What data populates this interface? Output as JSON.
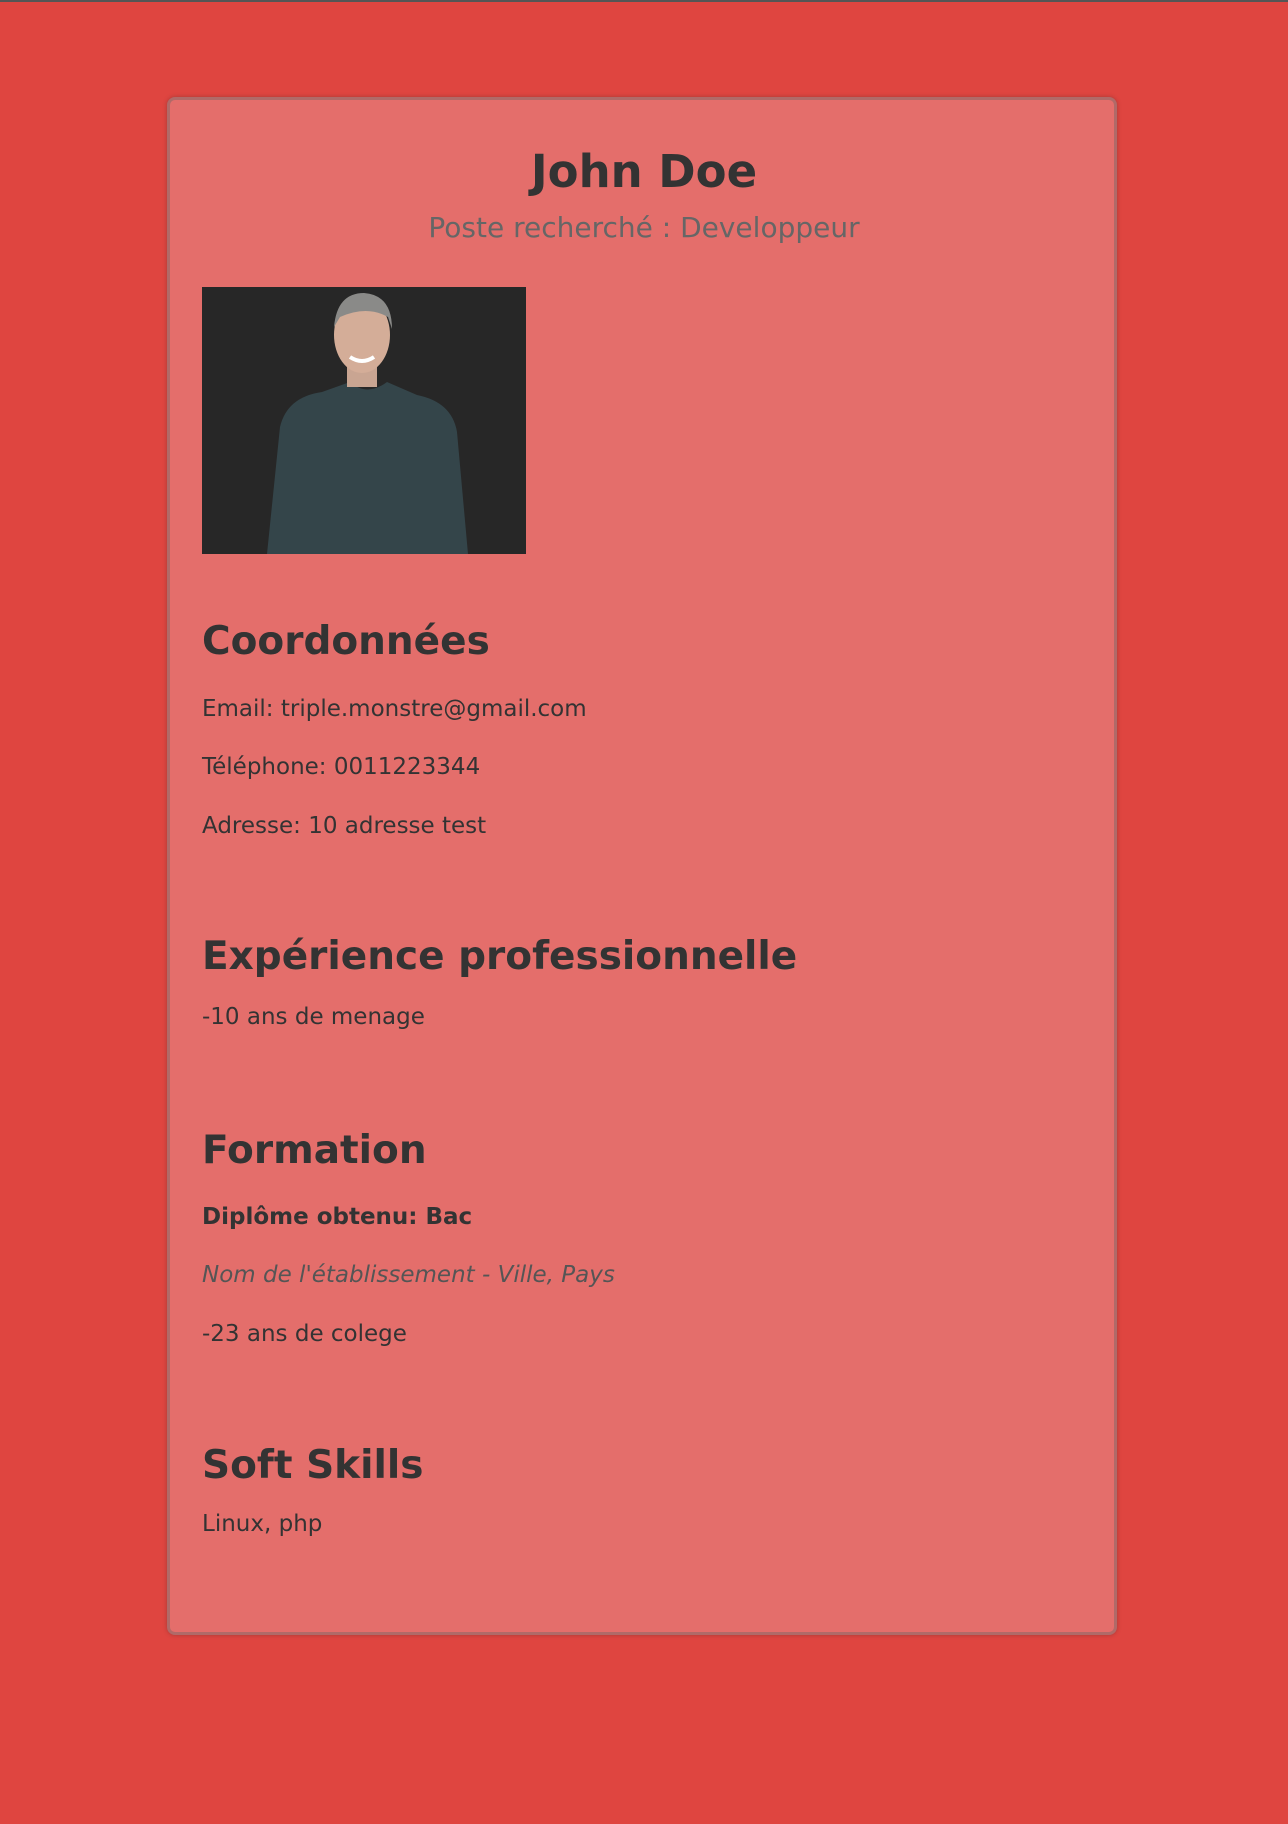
{
  "header": {
    "name": "John Doe",
    "subtitle": "Poste recherché : Developpeur"
  },
  "contact": {
    "title": "Coordonnées",
    "email": "Email: triple.monstre@gmail.com",
    "phone": "Téléphone: 0011223344",
    "address": "Adresse: 10 adresse test"
  },
  "experience": {
    "title": "Expérience professionnelle",
    "items": [
      "-10 ans de menage"
    ]
  },
  "education": {
    "title": "Formation",
    "degree": "Diplôme obtenu: Bac",
    "school": "Nom de l'établissement - Ville, Pays",
    "details": "-23 ans de colege"
  },
  "skills": {
    "title": "Soft Skills",
    "list": "Linux, php"
  },
  "colors": {
    "background": "#df4540",
    "card": "#e46e6b",
    "text": "#333333",
    "muted": "#666666"
  }
}
